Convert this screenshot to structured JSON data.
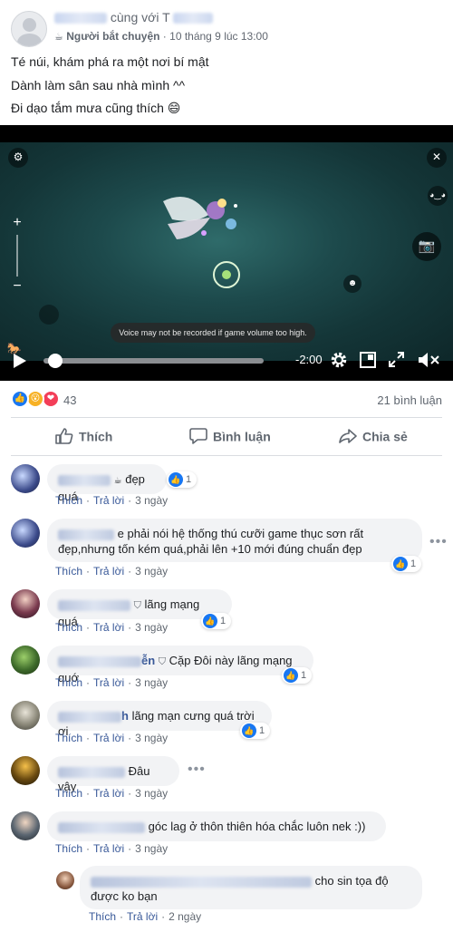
{
  "post": {
    "author_suffix": "cùng với T",
    "activity": "Người bắt chuyện",
    "timestamp": "10 tháng 9 lúc 13:00",
    "lines": [
      "Té núi, khám phá ra một nơi bí mật",
      "Dành làm sân sau nhà mình ^^",
      "Đi dạo tắm mưa cũng thích 😄"
    ]
  },
  "video": {
    "toast": "Voice may not be recorded if game volume too high.",
    "time_remaining": "-2:00",
    "progress_fraction": 0.03
  },
  "stats": {
    "reaction_count": "43",
    "comment_count": "21 bình luận"
  },
  "actions": {
    "like": "Thích",
    "comment": "Bình luận",
    "share": "Chia sẻ"
  },
  "comment_actions": {
    "like": "Thích",
    "reply": "Trả lời",
    "sep": "·"
  },
  "comments": [
    {
      "text": "đẹp quá",
      "likes": "1",
      "age": "3 ngày"
    },
    {
      "text_1": "e phải nói hệ thống thú cưỡi game thục sơn rất",
      "text_2": "đẹp,nhưng tốn kém quá,phải lên +10 mới đúng chuẩn đẹp",
      "likes": "1",
      "age": "3 ngày"
    },
    {
      "text": "lãng mạng quá",
      "likes": "1",
      "age": "3 ngày"
    },
    {
      "name_tail": "ễn",
      "text": "Cặp Đôi này lãng mạng quớ",
      "likes": "1",
      "age": "3 ngày"
    },
    {
      "name_tail": "h",
      "text": "lãng mạn cưng quá trời ơi",
      "likes": "1",
      "age": "3 ngày"
    },
    {
      "text": "Đâu vậy",
      "age": "3 ngày"
    },
    {
      "text": "góc lag ở thôn thiên hóa chắc luôn nek :))",
      "age": "3 ngày"
    },
    {
      "text_1": "cho sin tọa độ",
      "text_2": "được ko bạn",
      "age": "2 ngày"
    }
  ],
  "icons": {
    "settings": "⚙",
    "close": "✕",
    "camera": "📷",
    "play": "▶",
    "like_thumb": "👍",
    "emoji_face": "😮",
    "heart": "❤",
    "more": "•••"
  },
  "colors": {
    "facebook_blue": "#1877f2",
    "link_blue": "#385898",
    "love_red": "#f33e58",
    "wow_yellow": "#f7b125"
  }
}
